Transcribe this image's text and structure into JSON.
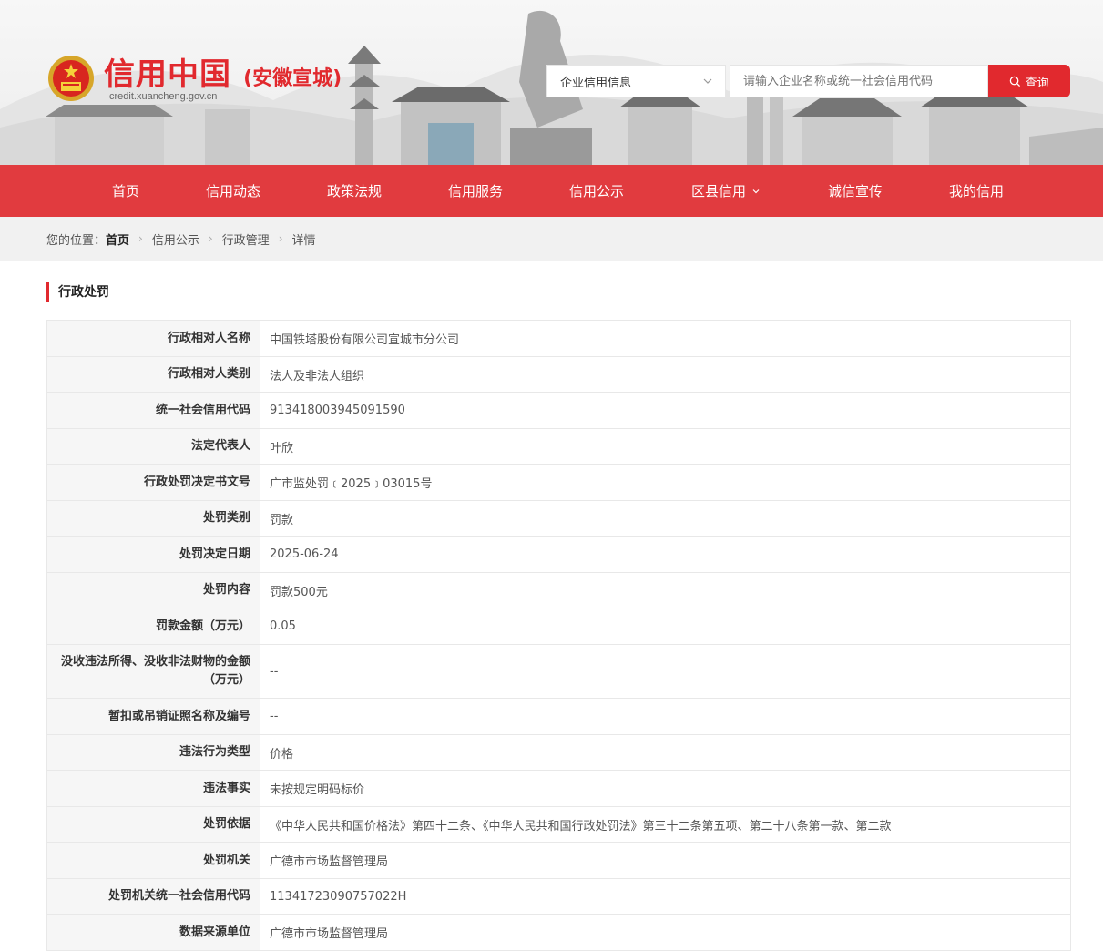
{
  "header": {
    "site_title": "信用中国",
    "site_region": "(安徽宣城)",
    "site_url": "credit.xuancheng.gov.cn",
    "search_select": "企业信用信息",
    "search_placeholder": "请输入企业名称或统一社会信用代码",
    "search_button": "查询",
    "accent_color": "#e1292e"
  },
  "nav": {
    "items": [
      "首页",
      "信用动态",
      "政策法规",
      "信用服务",
      "信用公示",
      "区县信用",
      "诚信宣传",
      "我的信用"
    ]
  },
  "breadcrumb": {
    "prefix": "您的位置：",
    "home": "首页",
    "items": [
      "信用公示",
      "行政管理",
      "详情"
    ]
  },
  "section": {
    "title": "行政处罚"
  },
  "details": [
    {
      "label": "行政相对人名称",
      "value": "中国铁塔股份有限公司宣城市分公司"
    },
    {
      "label": "行政相对人类别",
      "value": "法人及非法人组织"
    },
    {
      "label": "统一社会信用代码",
      "value": "913418003945091590"
    },
    {
      "label": "法定代表人",
      "value": "叶欣"
    },
    {
      "label": "行政处罚决定书文号",
      "value": "广市监处罚﹝2025﹞03015号"
    },
    {
      "label": "处罚类别",
      "value": "罚款"
    },
    {
      "label": "处罚决定日期",
      "value": "2025-06-24"
    },
    {
      "label": "处罚内容",
      "value": "罚款500元"
    },
    {
      "label": "罚款金额（万元）",
      "value": "0.05"
    },
    {
      "label": "没收违法所得、没收非法财物的金额（万元）",
      "value": "--"
    },
    {
      "label": "暂扣或吊销证照名称及编号",
      "value": "--"
    },
    {
      "label": "违法行为类型",
      "value": "价格"
    },
    {
      "label": "违法事实",
      "value": "未按规定明码标价"
    },
    {
      "label": "处罚依据",
      "value": "《中华人民共和国价格法》第四十二条、《中华人民共和国行政处罚法》第三十二条第五项、第二十八条第一款、第二款"
    },
    {
      "label": "处罚机关",
      "value": "广德市市场监督管理局"
    },
    {
      "label": "处罚机关统一社会信用代码",
      "value": "11341723090757022H"
    },
    {
      "label": "数据来源单位",
      "value": "广德市市场监督管理局"
    }
  ]
}
